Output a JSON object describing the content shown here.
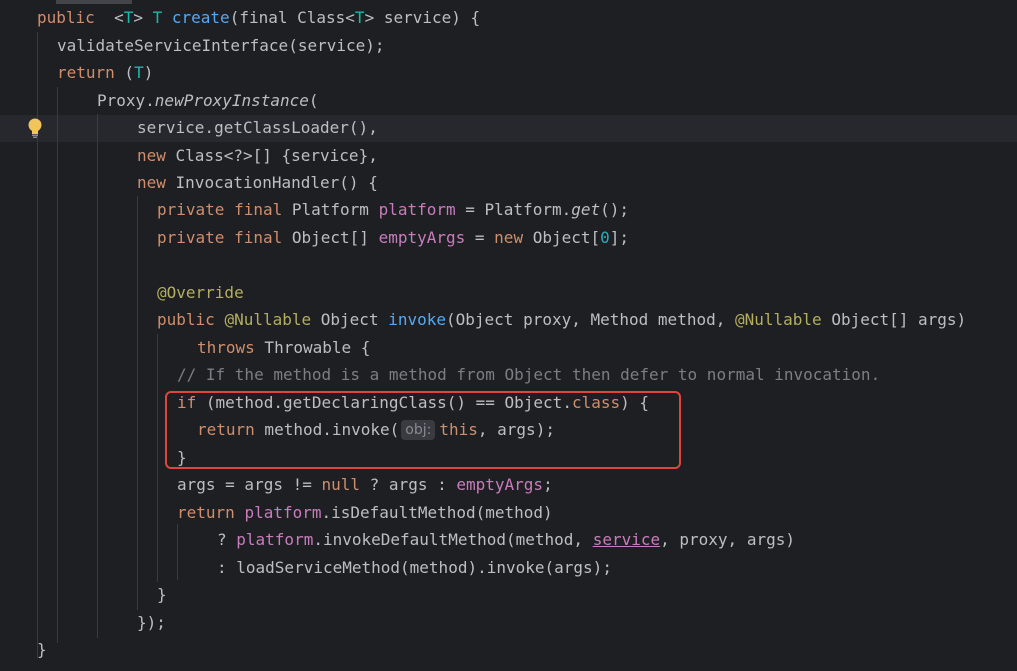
{
  "editor": {
    "lines": [
      {
        "id": "l1",
        "t": [
          [
            "kw",
            "public"
          ],
          [
            "",
            "  <"
          ],
          [
            "tp",
            "T"
          ],
          [
            "",
            "> "
          ],
          [
            "tp",
            "T"
          ],
          [
            "",
            " "
          ],
          [
            "fn",
            "create"
          ],
          [
            "",
            "(final Class<"
          ],
          [
            "tp",
            "T"
          ],
          [
            "",
            "> service) {"
          ]
        ]
      },
      {
        "id": "l2",
        "t": [
          [
            "",
            "validateServiceInterface(service);"
          ]
        ]
      },
      {
        "id": "l3",
        "t": [
          [
            "kw",
            "return"
          ],
          [
            "",
            " ("
          ],
          [
            "tp",
            "T"
          ],
          [
            "",
            ")"
          ]
        ]
      },
      {
        "id": "l4",
        "t": [
          [
            "",
            "Proxy."
          ],
          [
            "ital",
            "newProxyInstance"
          ],
          [
            "",
            "("
          ]
        ]
      },
      {
        "id": "l5",
        "t": [
          [
            "",
            "service.getClassLoader(),"
          ]
        ]
      },
      {
        "id": "l6",
        "t": [
          [
            "kw",
            "new"
          ],
          [
            "",
            " Class<?>[] {service},"
          ]
        ]
      },
      {
        "id": "l7",
        "t": [
          [
            "kw",
            "new"
          ],
          [
            "",
            " InvocationHandler() {"
          ]
        ]
      },
      {
        "id": "l8",
        "t": [
          [
            "kw",
            "private final"
          ],
          [
            "",
            " Platform "
          ],
          [
            "fld",
            "platform"
          ],
          [
            "",
            " = Platform."
          ],
          [
            "ital",
            "get"
          ],
          [
            "",
            "();"
          ]
        ]
      },
      {
        "id": "l9",
        "t": [
          [
            "kw",
            "private final"
          ],
          [
            "",
            " Object[] "
          ],
          [
            "fld",
            "emptyArgs"
          ],
          [
            "",
            " = "
          ],
          [
            "kw",
            "new"
          ],
          [
            "",
            " Object["
          ],
          [
            "num",
            "0"
          ],
          [
            "",
            "];"
          ]
        ]
      },
      {
        "id": "l10",
        "t": []
      },
      {
        "id": "l11",
        "t": [
          [
            "ann",
            "@Override"
          ]
        ]
      },
      {
        "id": "l12",
        "t": [
          [
            "kw",
            "public"
          ],
          [
            "",
            " "
          ],
          [
            "ann",
            "@Nullable"
          ],
          [
            "",
            " Object "
          ],
          [
            "fn",
            "invoke"
          ],
          [
            "",
            "(Object proxy, Method method, "
          ],
          [
            "ann",
            "@Nullable"
          ],
          [
            "",
            " Object[] args)"
          ]
        ]
      },
      {
        "id": "l13",
        "t": [
          [
            "kw",
            "throws"
          ],
          [
            "",
            " Throwable {"
          ]
        ]
      },
      {
        "id": "l14",
        "t": [
          [
            "cmt",
            "// If the method is a method from Object then defer to normal invocation."
          ]
        ]
      },
      {
        "id": "l15",
        "t": [
          [
            "kw",
            "if"
          ],
          [
            "",
            " (method.getDeclaringClass() == Object."
          ],
          [
            "kw",
            "class"
          ],
          [
            "",
            ") {"
          ]
        ]
      },
      {
        "id": "l16",
        "t": [
          [
            "kw",
            "return"
          ],
          [
            "",
            " method.invoke("
          ],
          [
            "hint",
            "obj:"
          ],
          [
            "kw",
            "this"
          ],
          [
            "",
            ", args);"
          ]
        ]
      },
      {
        "id": "l17",
        "t": [
          [
            "",
            "}"
          ]
        ]
      },
      {
        "id": "l18",
        "t": [
          [
            "",
            "args = args != "
          ],
          [
            "kw",
            "null"
          ],
          [
            "",
            " ? args : "
          ],
          [
            "fld",
            "emptyArgs"
          ],
          [
            "",
            ";"
          ]
        ]
      },
      {
        "id": "l19",
        "t": [
          [
            "kw",
            "return"
          ],
          [
            "",
            " "
          ],
          [
            "fld",
            "platform"
          ],
          [
            "",
            ".isDefaultMethod(method)"
          ]
        ]
      },
      {
        "id": "l20",
        "t": [
          [
            "",
            "? "
          ],
          [
            "fld",
            "platform"
          ],
          [
            "",
            ".invokeDefaultMethod(method, "
          ],
          [
            "fldund",
            "service"
          ],
          [
            "",
            ", proxy, args)"
          ]
        ]
      },
      {
        "id": "l21",
        "t": [
          [
            "",
            ": loadServiceMethod(method).invoke(args);"
          ]
        ]
      },
      {
        "id": "l22",
        "t": [
          [
            "",
            "}"
          ]
        ]
      },
      {
        "id": "l23",
        "t": [
          [
            "",
            "});"
          ]
        ]
      },
      {
        "id": "l24",
        "t": [
          [
            "",
            "}"
          ]
        ]
      }
    ]
  },
  "gutter": {
    "intention_icon": "lightbulb-icon"
  },
  "colors": {
    "background": "#1e1f22",
    "keyword": "#cf8e6d",
    "function": "#56a8f5",
    "field": "#c77dbb",
    "number": "#2aacb8",
    "annotation": "#b3ae60",
    "comment": "#7a7e85",
    "highlight": "#e0443e"
  }
}
